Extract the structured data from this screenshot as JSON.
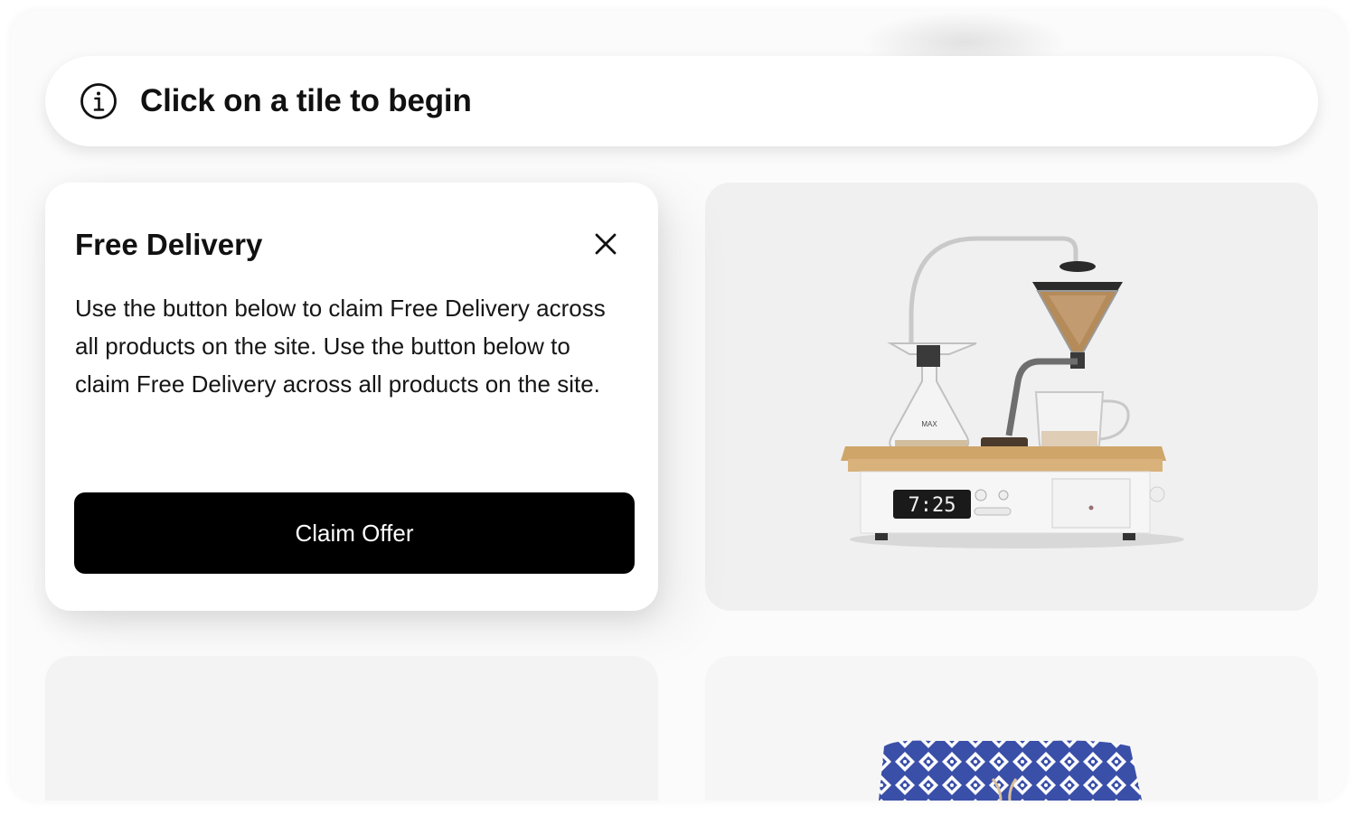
{
  "banner": {
    "icon": "info-icon",
    "title": "Click on a tile to begin"
  },
  "offer_card": {
    "heading": "Free Delivery",
    "body": "Use the button below to claim Free Delivery across all products on the site. Use the button below to claim Free Delivery across all products on the site.",
    "button_label": "Claim Offer",
    "close_icon": "close-icon"
  },
  "tiles": [
    {
      "name": "coffee-alarm-clock-product",
      "clock_display": "7:25"
    },
    {
      "name": "empty-tile"
    },
    {
      "name": "patterned-shorts-product"
    }
  ],
  "colors": {
    "button": "#000000",
    "shorts_pattern": "#3a4fa8"
  }
}
